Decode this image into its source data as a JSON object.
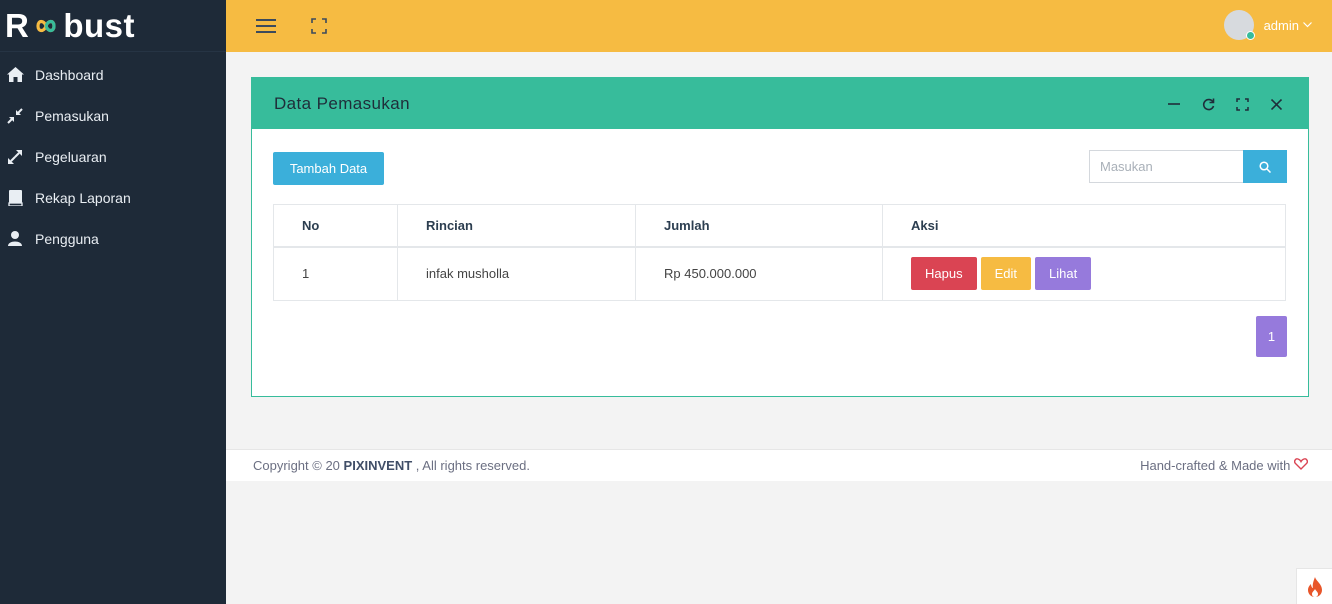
{
  "brand": {
    "prefix": "R",
    "suffix": "bust",
    "logo_colors": [
      "#f6bb42",
      "#37bc9b"
    ]
  },
  "sidebar": {
    "items": [
      {
        "label": "Dashboard",
        "icon": "home-icon"
      },
      {
        "label": "Pemasukan",
        "icon": "compress-icon"
      },
      {
        "label": "Pegeluaran",
        "icon": "expand-icon"
      },
      {
        "label": "Rekap Laporan",
        "icon": "book-icon"
      },
      {
        "label": "Pengguna",
        "icon": "user-icon"
      }
    ]
  },
  "topbar": {
    "menu_icon": "hamburger-icon",
    "fullscreen_icon": "fullscreen-icon",
    "user_name": "admin",
    "user_status_color": "#37bc9b"
  },
  "card": {
    "title": "Data Pemasukan",
    "tools": [
      "minimize-icon",
      "reload-icon",
      "expand-icon",
      "close-icon"
    ],
    "add_button": "Tambah Data",
    "search": {
      "placeholder": "Masukan",
      "value": ""
    },
    "table": {
      "headers": [
        "No",
        "Rincian",
        "Jumlah",
        "Aksi"
      ],
      "rows": [
        {
          "no": "1",
          "rincian": "infak musholla",
          "jumlah": "Rp 450.000.000",
          "actions": [
            "Hapus",
            "Edit",
            "Lihat"
          ]
        }
      ]
    },
    "pagination": {
      "current": "1"
    }
  },
  "footer": {
    "copyright_prefix": "Copyright © 20",
    "company": "PIXINVENT",
    "rights": ", All rights reserved.",
    "crafted": "Hand-crafted & Made with"
  },
  "colors": {
    "sidebar": "#1e2a38",
    "topbar": "#f6bb42",
    "card_header": "#37bc9b",
    "primary": "#3bafda",
    "danger": "#da4453",
    "warning": "#f6bb42",
    "purple": "#967adc"
  }
}
